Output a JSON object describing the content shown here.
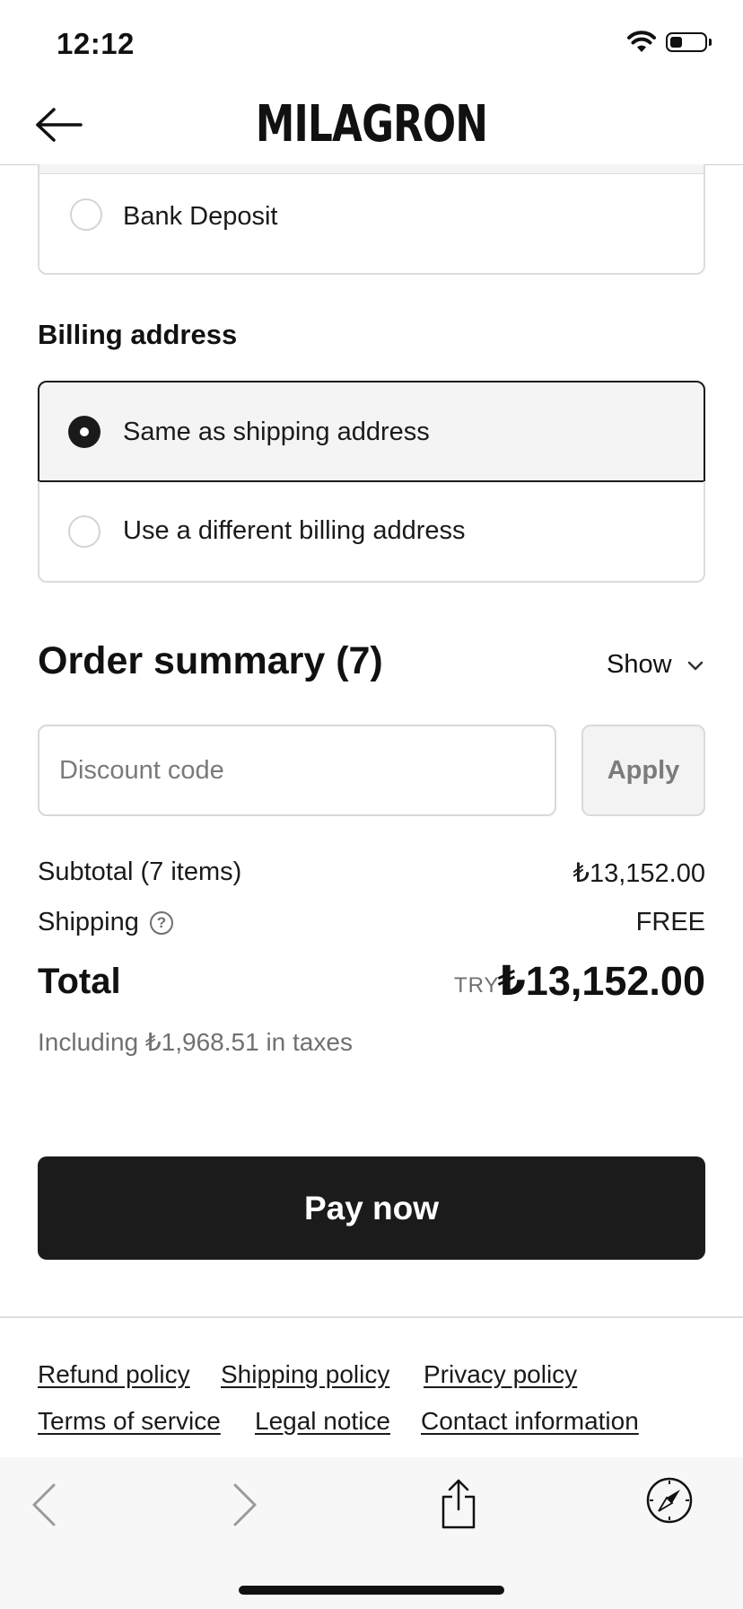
{
  "status_bar": {
    "time": "12:12",
    "battery_level": 0.35
  },
  "header": {
    "brand": "MILAGRON",
    "back_icon": "arrow-left-icon"
  },
  "payment": {
    "options": [
      {
        "label": "Bank Deposit",
        "selected": false
      }
    ]
  },
  "billing": {
    "title": "Billing address",
    "options": [
      {
        "label": "Same as shipping address",
        "selected": true
      },
      {
        "label": "Use a different billing address",
        "selected": false
      }
    ]
  },
  "summary": {
    "title": "Order summary (7)",
    "toggle_label": "Show",
    "discount": {
      "placeholder": "Discount code",
      "apply_label": "Apply"
    },
    "subtotal_label": "Subtotal (7 items)",
    "subtotal_value": "₺13,152.00",
    "shipping_label": "Shipping",
    "shipping_value": "FREE",
    "help_glyph": "?",
    "total_label": "Total",
    "total_currency": "TRY",
    "total_value": "₺13,152.00",
    "tax_note": "Including ₺1,968.51 in taxes"
  },
  "pay_button": "Pay now",
  "policies": [
    "Refund policy",
    "Shipping policy",
    "Privacy policy",
    "Terms of service",
    "Legal notice",
    "Contact information"
  ],
  "toolbar": {
    "icons": [
      "back-chevron-icon",
      "forward-chevron-icon",
      "share-icon",
      "compass-icon"
    ]
  }
}
